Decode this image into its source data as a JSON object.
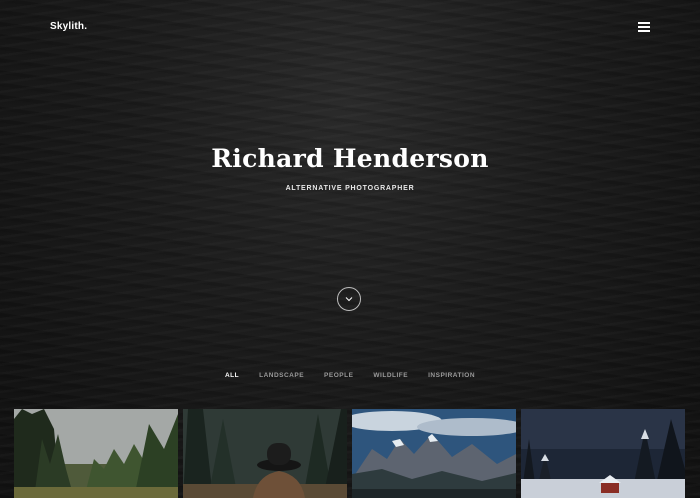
{
  "header": {
    "logo": "Skylith.",
    "menu_icon": "hamburger-menu-icon"
  },
  "hero": {
    "title": "Richard Henderson",
    "subtitle": "ALTERNATIVE PHOTOGRAPHER",
    "scroll_icon": "chevron-down-icon"
  },
  "filters": {
    "items": [
      {
        "label": "ALL",
        "active": true
      },
      {
        "label": "LANDSCAPE",
        "active": false
      },
      {
        "label": "PEOPLE",
        "active": false
      },
      {
        "label": "WILDLIFE",
        "active": false
      },
      {
        "label": "INSPIRATION",
        "active": false
      }
    ]
  },
  "gallery": {
    "tiles": [
      {
        "subject": "forest-trees",
        "sky": "#9aa0a2"
      },
      {
        "subject": "hat-person-in-forest",
        "sky": "#2f3a36"
      },
      {
        "subject": "mountains-cloudy-sky",
        "sky": "#2b4a6e"
      },
      {
        "subject": "snowy-forest-night",
        "sky": "#1f2a3a"
      }
    ]
  },
  "colors": {
    "background": "#121212",
    "text": "#ffffff",
    "muted": "#9a9a9a"
  }
}
